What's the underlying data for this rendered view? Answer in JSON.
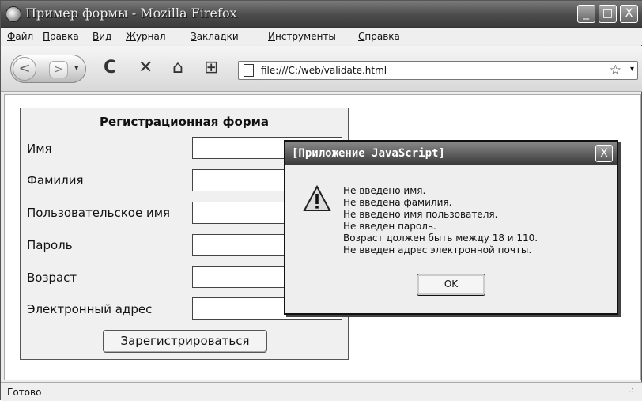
{
  "window": {
    "title": "Пример формы - Mozilla Firefox",
    "buttons": [
      "_",
      "□",
      "X"
    ]
  },
  "menu": [
    {
      "label": "Файл",
      "accel": "Ф",
      "rest": "айл"
    },
    {
      "label": "Правка",
      "accel": "П",
      "rest": "равка"
    },
    {
      "label": "Вид",
      "accel": "В",
      "rest": "ид"
    },
    {
      "label": "Журнал",
      "accel": "Ж",
      "rest": "урнал"
    },
    {
      "label": "Закладки",
      "accel": "З",
      "rest": "акладки"
    },
    {
      "label": "Инструменты",
      "accel": "И",
      "rest": "нструменты"
    },
    {
      "label": "Справка",
      "accel": "С",
      "rest": "правка"
    }
  ],
  "toolbar": {
    "back": "<",
    "forward": ">",
    "dropdown": "▾",
    "reload": "C",
    "stop": "✕",
    "home": "⌂",
    "bookmarks": "⊞",
    "url": "file:///C:/web/validate.html",
    "star": "☆",
    "url_dropdown": "▾"
  },
  "form": {
    "title": "Регистрационная форма",
    "fields": [
      {
        "label": "Имя",
        "value": ""
      },
      {
        "label": "Фамилия",
        "value": ""
      },
      {
        "label": "Пользовательское имя",
        "value": ""
      },
      {
        "label": "Пароль",
        "value": ""
      },
      {
        "label": "Возраст",
        "value": ""
      },
      {
        "label": "Электронный адрес",
        "value": ""
      }
    ],
    "submit": "Зарегистрироваться"
  },
  "status": {
    "text": "Готово",
    "grip": ".:"
  },
  "dialog": {
    "title": "[Приложение JavaScript]",
    "close": "X",
    "icon": "warning-icon",
    "messages": [
      "Не введено имя.",
      "Не введена фамилия.",
      "Не введено имя пользователя.",
      "Не введен пароль.",
      "Возраст должен быть между 18 и 110.",
      "Не введен адрес электронной почты."
    ],
    "ok": "OK"
  }
}
